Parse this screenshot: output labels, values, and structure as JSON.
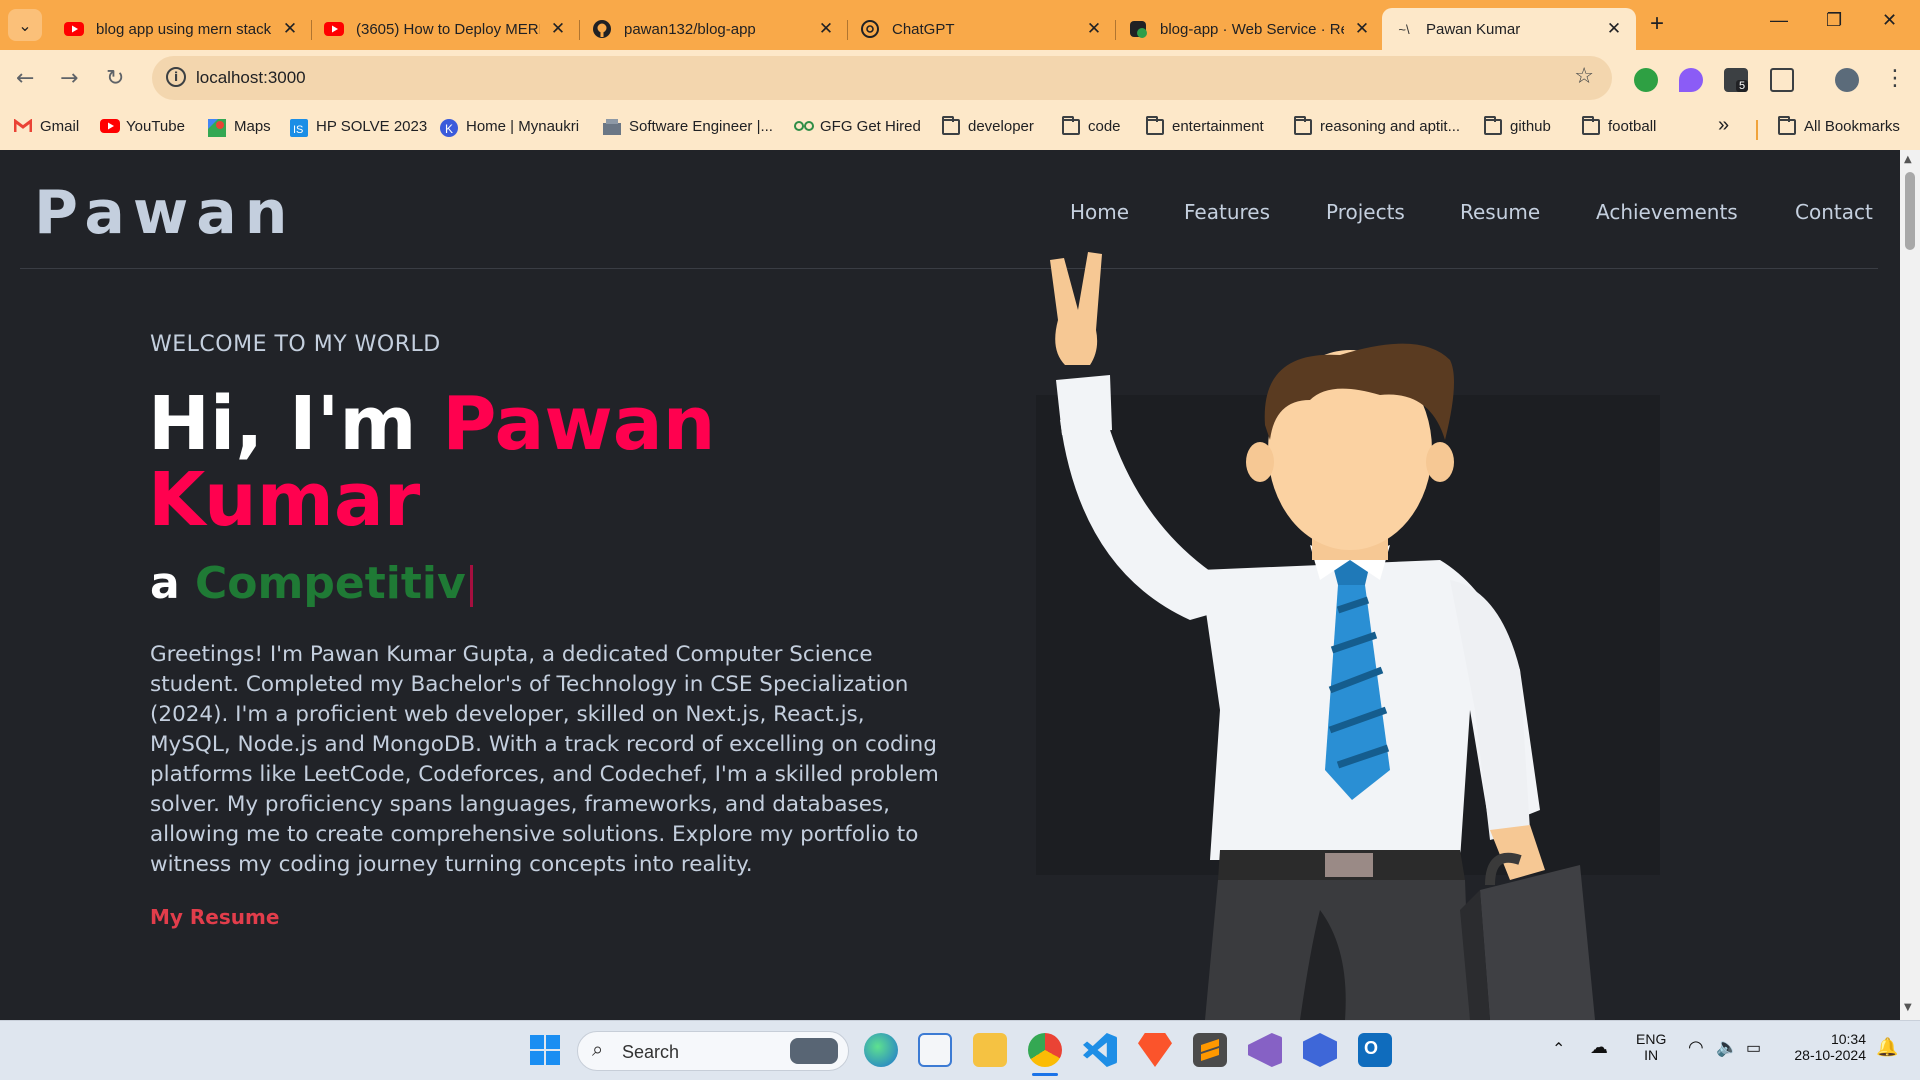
{
  "browser": {
    "tabs": [
      {
        "title": "blog app using mern stack",
        "icon": "youtube-icon"
      },
      {
        "title": "(3605) How to Deploy MERN",
        "icon": "youtube-icon"
      },
      {
        "title": "pawan132/blog-app",
        "icon": "github-icon"
      },
      {
        "title": "ChatGPT",
        "icon": "chatgpt-icon"
      },
      {
        "title": "blog-app · Web Service · Re",
        "icon": "render-icon"
      },
      {
        "title": "Pawan Kumar",
        "icon": "page-icon",
        "active": true
      }
    ],
    "url": "localhost:3000",
    "extension_badge": "5",
    "bookmarks": [
      {
        "label": "Gmail",
        "icon": "gmail-icon"
      },
      {
        "label": "YouTube",
        "icon": "youtube-icon"
      },
      {
        "label": "Maps",
        "icon": "maps-icon"
      },
      {
        "label": "HP SOLVE 2023",
        "icon": "hp-icon"
      },
      {
        "label": "Home | Mynaukri",
        "icon": "mynaukri-icon"
      },
      {
        "label": "Software Engineer |...",
        "icon": "site-icon"
      },
      {
        "label": "GFG Get Hired",
        "icon": "gfg-icon"
      },
      {
        "label": "developer",
        "icon": "folder-icon"
      },
      {
        "label": "code",
        "icon": "folder-icon"
      },
      {
        "label": "entertainment",
        "icon": "folder-icon"
      },
      {
        "label": "reasoning and aptit...",
        "icon": "folder-icon"
      },
      {
        "label": "github",
        "icon": "folder-icon"
      },
      {
        "label": "football",
        "icon": "folder-icon"
      }
    ],
    "more_bookmarks": "»",
    "all_bookmarks": "All Bookmarks"
  },
  "site": {
    "logo": "Pawan",
    "nav": [
      "Home",
      "Features",
      "Projects",
      "Resume",
      "Achievements",
      "Contact"
    ],
    "welcome": "WELCOME TO MY WORLD",
    "greeting_prefix": "Hi, I'm ",
    "name_first": "Pawan",
    "name_last": "Kumar",
    "typed_prefix": "a ",
    "typed_role": "Competitiv",
    "intro": "Greetings! I'm Pawan Kumar Gupta, a dedicated Computer Science student. Completed my Bachelor's of Technology in CSE Specialization (2024). I'm a proficient web developer, skilled on Next.js, React.js, MySQL, Node.js and MongoDB. With a track record of excelling on coding platforms like LeetCode, Codeforces, and Codechef, I'm a skilled problem solver. My proficiency spans languages, frameworks, and databases, allowing me to create comprehensive solutions. Explore my portfolio to witness my coding journey turning concepts into reality.",
    "resume_link": "My Resume",
    "colors": {
      "accent": "#ff014f",
      "background": "#212328",
      "text": "#c4cfde",
      "role": "#1f7a35"
    }
  },
  "taskbar": {
    "search_placeholder": "Search",
    "language": "ENG",
    "region": "IN",
    "time": "10:34",
    "date": "28-10-2024"
  }
}
